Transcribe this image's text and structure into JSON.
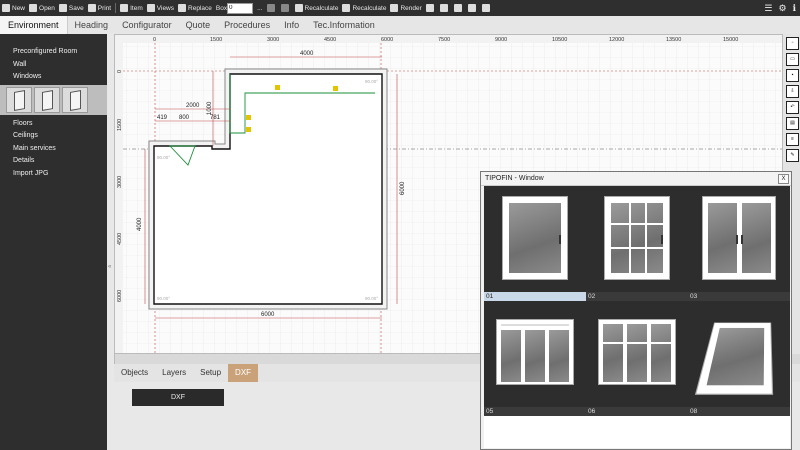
{
  "toolbar": {
    "new": "New",
    "open": "Open",
    "save": "Save",
    "print": "Print",
    "item": "Item",
    "views": "Views",
    "replace": "Replace",
    "box_label": "Box",
    "box_value": "0",
    "more": "...",
    "recalculate1": "Recalculate",
    "recalculate2": "Recalculate",
    "render": "Render"
  },
  "tabs": [
    "Environment",
    "Heading",
    "Configurator",
    "Quote",
    "Procedures",
    "Info",
    "Tec.Information"
  ],
  "sidebar": {
    "items_top": [
      "Preconfigured Room",
      "Wall",
      "Windows"
    ],
    "items_bottom": [
      "Floors",
      "Ceilings",
      "Main services",
      "Details",
      "Import JPG"
    ]
  },
  "ruler": {
    "x_ticks": [
      "0",
      "1500",
      "3000",
      "4500",
      "6000",
      "7500",
      "9000",
      "10500",
      "12000",
      "13500",
      "15000"
    ],
    "y_ticks": [
      "0",
      "1500",
      "3000",
      "4500",
      "6000"
    ]
  },
  "dimensions": {
    "top_width": "4000",
    "left_width": "2000",
    "seg1": "419",
    "seg2": "800",
    "seg3": "781",
    "step_height": "1000",
    "left_height": "4000",
    "right_height": "6000",
    "bottom_width": "6000",
    "corner": "90.00°"
  },
  "bottom_tabs": [
    "Objects",
    "Layers",
    "Setup",
    "DXF"
  ],
  "bottom_active": "DXF",
  "dxf_button": "DXF",
  "dialog": {
    "title": "TIPOFIN - Window",
    "close": "X",
    "cells": [
      "01",
      "02",
      "03",
      "05",
      "06",
      "08"
    ]
  },
  "colors": {
    "active_tab": "#c9a27a",
    "sidebar": "#2e2e2e",
    "toolbar": "#2f2f2f"
  }
}
